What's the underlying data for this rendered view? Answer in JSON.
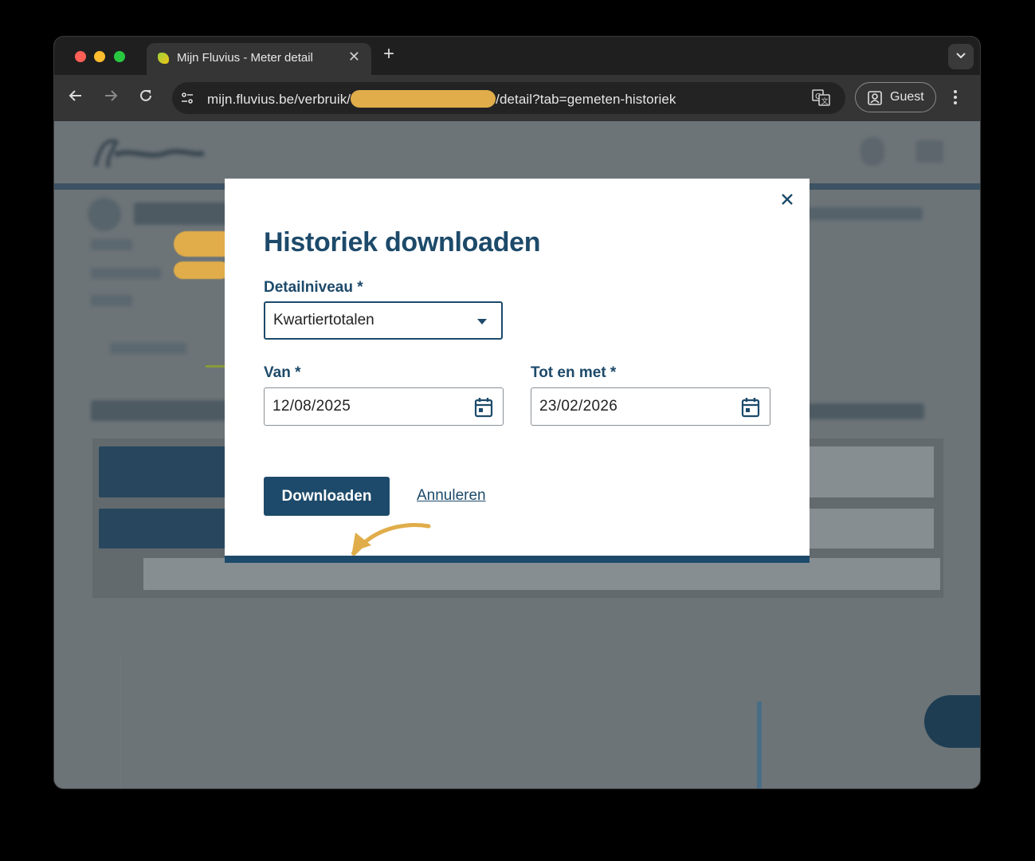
{
  "browser": {
    "tab_title": "Mijn Fluvius - Meter detail",
    "tab_close_icon": "close-icon",
    "new_tab_label": "+",
    "url_prefix": "mijn.fluvius.be/verbruik/",
    "url_suffix": "/detail?tab=gemeten-historiek",
    "profile_label": "Guest"
  },
  "modal": {
    "title": "Historiek downloaden",
    "detail_label": "Detailniveau *",
    "detail_value": "Kwartiertotalen",
    "from_label": "Van *",
    "from_value": "12/08/2025",
    "to_label": "Tot en met *",
    "to_value": "23/02/2026",
    "download_label": "Downloaden",
    "cancel_label": "Annuleren"
  },
  "colors": {
    "brand_navy": "#1d4a6a",
    "annotation_arrow": "#e0ad4a",
    "redaction": "#e0ad4a"
  }
}
